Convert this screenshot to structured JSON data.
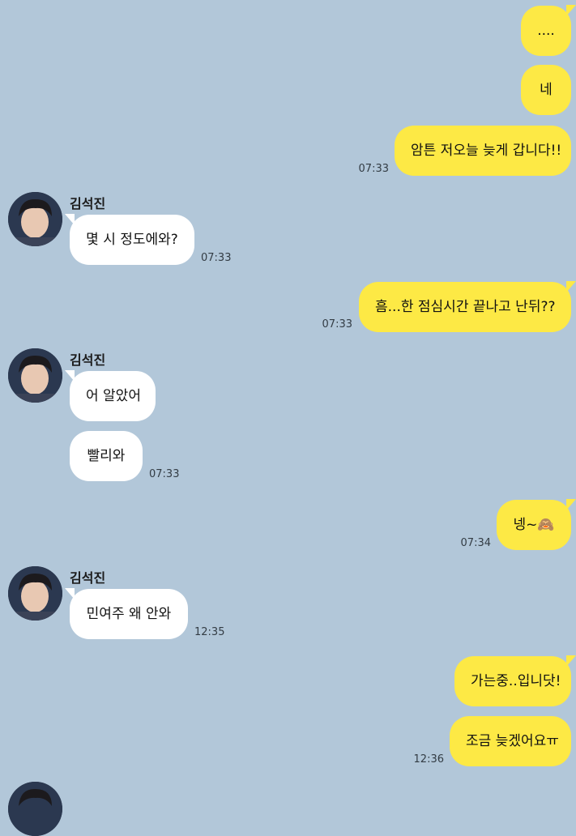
{
  "chat": {
    "background": "#b2c7d9",
    "my_bubble_color": "#fde945",
    "their_bubble_color": "#ffffff",
    "contact_name": "김석진",
    "messages": [
      {
        "sender": "me",
        "text": "....",
        "time": ""
      },
      {
        "sender": "me",
        "text": "네",
        "time": ""
      },
      {
        "sender": "me",
        "text": "암튼 저오늘 늦게 갑니다!!",
        "time": "07:33"
      },
      {
        "sender": "other",
        "text": "몇 시 정도에와?",
        "time": "07:33"
      },
      {
        "sender": "me",
        "text": "흠...한 점심시간 끝나고 난뒤??",
        "time": "07:33"
      },
      {
        "sender": "other",
        "text": "어 알았어",
        "time": ""
      },
      {
        "sender": "other",
        "text": "빨리와",
        "time": "07:33"
      },
      {
        "sender": "me",
        "text": "넹~🙈",
        "time": "07:34"
      },
      {
        "sender": "other",
        "text": "민여주 왜 안와",
        "time": "12:35"
      },
      {
        "sender": "me",
        "text": "가는중..입니닷!",
        "time": ""
      },
      {
        "sender": "me",
        "text": "조금 늦겠어요ㅠ",
        "time": "12:36"
      }
    ]
  }
}
